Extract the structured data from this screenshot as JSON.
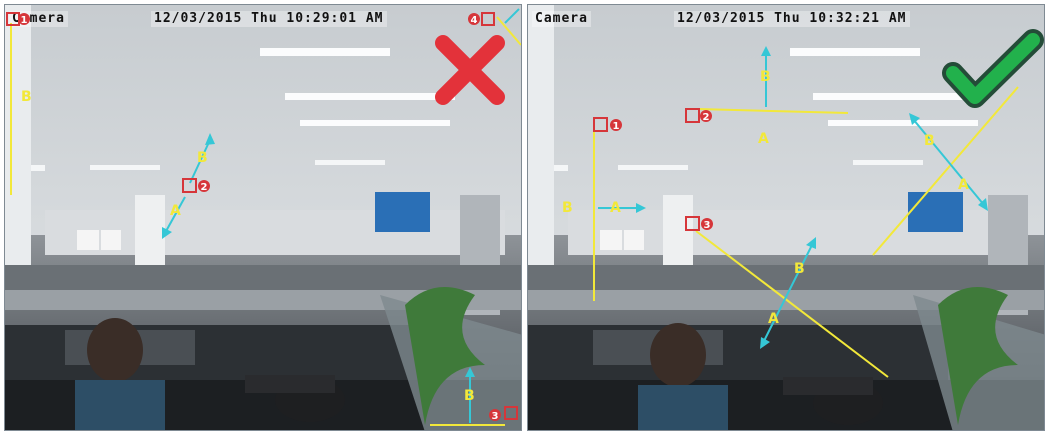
{
  "left": {
    "camera_label": "Camera",
    "datetime": "12/03/2015 Thu 10:29:01 AM",
    "markers": [
      "1",
      "2",
      "3",
      "4"
    ],
    "segment_labels": {
      "b1": "B",
      "b2": "B",
      "a2": "A",
      "b3": "B"
    },
    "verdict_icon": "red-x-icon"
  },
  "right": {
    "camera_label": "Camera",
    "datetime": "12/03/2015 Thu 10:32:21 AM",
    "markers": [
      "1",
      "2",
      "3"
    ],
    "segment_labels": {
      "b1": "B",
      "a1": "A",
      "b2": "B",
      "a2": "A",
      "b4": "B",
      "a4": "A",
      "b3": "B",
      "a3": "A"
    },
    "verdict_icon": "green-check-icon"
  },
  "colors": {
    "line": "#f2e83a",
    "arrow": "#35c7d6",
    "marker": "#d6363a",
    "cross": "#e3323a",
    "check": "#22b14c"
  }
}
